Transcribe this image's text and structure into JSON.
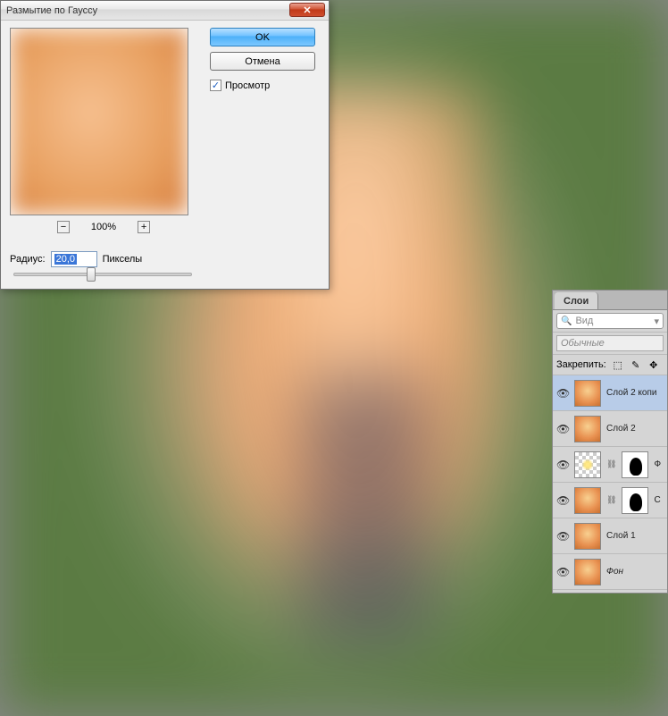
{
  "dialog": {
    "title": "Размытие по Гауссу",
    "ok_label": "OK",
    "cancel_label": "Отмена",
    "preview_label": "Просмотр",
    "preview_checked": true,
    "zoom_pct": "100%",
    "radius_label": "Радиус:",
    "radius_value": "20,0",
    "units_label": "Пикселы"
  },
  "layers_panel": {
    "tab_label": "Слои",
    "kind_label": "Вид",
    "blend_mode": "Обычные",
    "lock_label": "Закрепить:",
    "layers": [
      {
        "name": "Слой 2 копи",
        "selected": true,
        "thumb": "photo",
        "mask": null,
        "italic": false
      },
      {
        "name": "Слой 2",
        "selected": false,
        "thumb": "photo",
        "mask": null,
        "italic": false
      },
      {
        "name": "Ф",
        "selected": false,
        "thumb": "trans",
        "mask": "black",
        "italic": false
      },
      {
        "name": "С",
        "selected": false,
        "thumb": "photo",
        "mask": "black",
        "italic": false
      },
      {
        "name": "Слой 1",
        "selected": false,
        "thumb": "photo",
        "mask": null,
        "italic": false
      },
      {
        "name": "Фон",
        "selected": false,
        "thumb": "photo",
        "mask": null,
        "italic": true
      }
    ]
  }
}
